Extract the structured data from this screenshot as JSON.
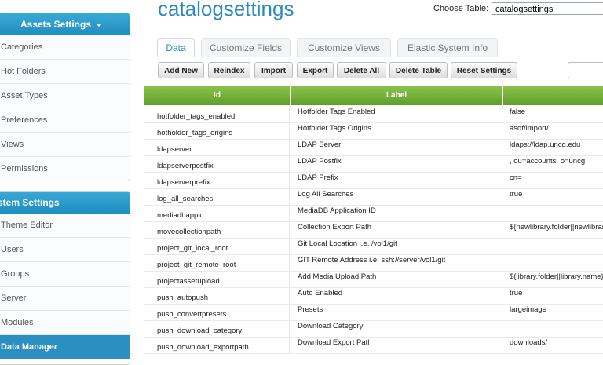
{
  "sidebar": {
    "assets_panel": {
      "title": "Assets Settings",
      "items": [
        "Categories",
        "Hot Folders",
        "Asset Types",
        "Preferences",
        "Views",
        "Permissions"
      ]
    },
    "system_panel": {
      "title": "stem Settings",
      "items": [
        "Theme Editor",
        "Users",
        "Groups",
        "Server",
        "Modules",
        "Data Manager"
      ],
      "active": "Data Manager"
    }
  },
  "header": {
    "title": "catalogsettings",
    "choose_table_label": "Choose Table:",
    "choose_table_value": "catalogsettings"
  },
  "tabs": [
    "Data",
    "Customize Fields",
    "Customize Views",
    "Elastic System Info"
  ],
  "active_tab": "Data",
  "toolbar": [
    "Add New",
    "Reindex",
    "Import",
    "Export",
    "Delete All",
    "Delete Table",
    "Reset Settings"
  ],
  "table": {
    "columns": [
      "Id",
      "Label",
      ""
    ],
    "rows": [
      {
        "id": "hotfolder_tags_enabled",
        "label": "Hotfolder Tags Enabled",
        "value": "false"
      },
      {
        "id": "hotholder_tags_origins",
        "label": "Hotfolder Tags Origins",
        "value": "asdf/import/"
      },
      {
        "id": "ldapserver",
        "label": "LDAP Server",
        "value": "ldaps://ldap.uncg.edu"
      },
      {
        "id": "ldapserverpostfix",
        "label": "LDAP Postfix",
        "value": ", ou=accounts, o=uncg"
      },
      {
        "id": "ldapserverprefix",
        "label": "LDAP Prefix",
        "value": "cn="
      },
      {
        "id": "log_all_searches",
        "label": "Log All Searches",
        "value": "true"
      },
      {
        "id": "mediadbappid",
        "label": "MediaDB Application ID",
        "value": ""
      },
      {
        "id": "movecollectionpath",
        "label": "Collection Export Path",
        "value": "${newlibrary.folder||newlibrary"
      },
      {
        "id": "project_git_local_root",
        "label": "Git Local Location i.e. /vol1/git",
        "value": ""
      },
      {
        "id": "project_git_remote_root",
        "label": "GIT Remote Address i.e. ssh://server/vol1/git",
        "value": ""
      },
      {
        "id": "projectassetupload",
        "label": "Add Media Upload Path",
        "value": "${library.folder||library.name}"
      },
      {
        "id": "push_autopush",
        "label": "Auto Enabled",
        "value": "true"
      },
      {
        "id": "push_convertpresets",
        "label": "Presets",
        "value": "largeimage"
      },
      {
        "id": "push_download_category",
        "label": "Download Category",
        "value": ""
      },
      {
        "id": "push_download_exportpath",
        "label": "Download Export Path",
        "value": "downloads/"
      }
    ]
  }
}
